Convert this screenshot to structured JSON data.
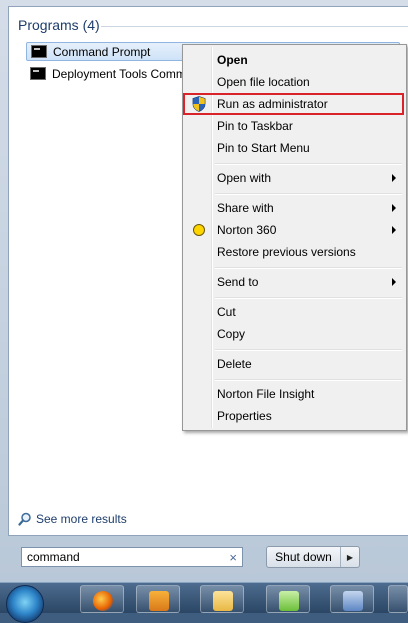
{
  "programs": {
    "header": "Programs (4)",
    "items": [
      {
        "label": "Command Prompt",
        "icon": "cmd-icon"
      },
      {
        "label": "Deployment Tools Comm",
        "icon": "cmd-icon"
      }
    ]
  },
  "see_more": "See more results",
  "search": {
    "value": "command",
    "clear": "×"
  },
  "shutdown": {
    "label": "Shut down",
    "arrow": "▶"
  },
  "context_menu": {
    "items": [
      {
        "label": "Open"
      },
      {
        "label": "Open file location"
      },
      {
        "label": "Run as administrator"
      },
      {
        "label": "Pin to Taskbar"
      },
      {
        "label": "Pin to Start Menu"
      },
      {
        "label": "Open with"
      },
      {
        "label": "Share with"
      },
      {
        "label": "Norton 360"
      },
      {
        "label": "Restore previous versions"
      },
      {
        "label": "Send to"
      },
      {
        "label": "Cut"
      },
      {
        "label": "Copy"
      },
      {
        "label": "Delete"
      },
      {
        "label": "Norton File Insight"
      },
      {
        "label": "Properties"
      }
    ]
  },
  "colors": {
    "highlight_box": "#d9222a",
    "norton_yellow": "#ffd500"
  },
  "taskbar": {
    "icons": [
      "start-orb",
      "firefox-icon",
      "outlook-icon",
      "explorer-icon",
      "app-icon",
      "virtualbox-icon",
      "app2-icon"
    ]
  }
}
